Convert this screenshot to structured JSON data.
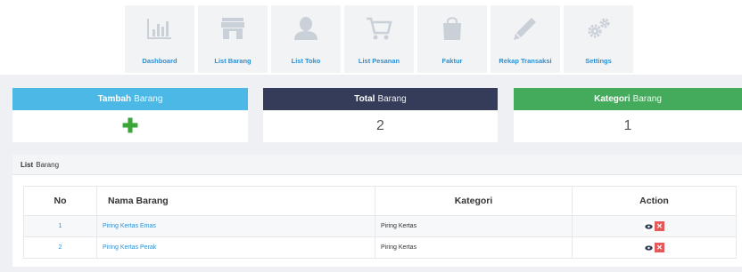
{
  "nav": [
    {
      "label": "Dashboard",
      "icon": "bar-chart-icon"
    },
    {
      "label": "List Barang",
      "icon": "store-icon"
    },
    {
      "label": "List Toko",
      "icon": "user-icon"
    },
    {
      "label": "List Pesanan",
      "icon": "cart-icon"
    },
    {
      "label": "Faktur",
      "icon": "bag-icon"
    },
    {
      "label": "Rekap Transaksi",
      "icon": "pencil-icon"
    },
    {
      "label": "Settings",
      "icon": "gears-icon"
    }
  ],
  "cards": {
    "tambah": {
      "bold": "Tambah",
      "thin": "Barang",
      "color": "#4cb8e6"
    },
    "total": {
      "bold": "Total",
      "thin": "Barang",
      "value": "2",
      "color": "#353c5a"
    },
    "kategori": {
      "bold": "Kategori",
      "thin": "Barang",
      "value": "1",
      "color": "#45ab5c"
    }
  },
  "list": {
    "title_bold": "List",
    "title_thin": "Barang",
    "columns": [
      "No",
      "Nama Barang",
      "Kategori",
      "Action"
    ],
    "rows": [
      {
        "no": "1",
        "nama": "Piring Kertas Emas",
        "kategori": "Piring Kertas"
      },
      {
        "no": "2",
        "nama": "Piring Kertas Perak",
        "kategori": "Piring Kertas"
      }
    ]
  },
  "colors": {
    "link": "#2f8fd0",
    "delete": "#e45a5a"
  }
}
